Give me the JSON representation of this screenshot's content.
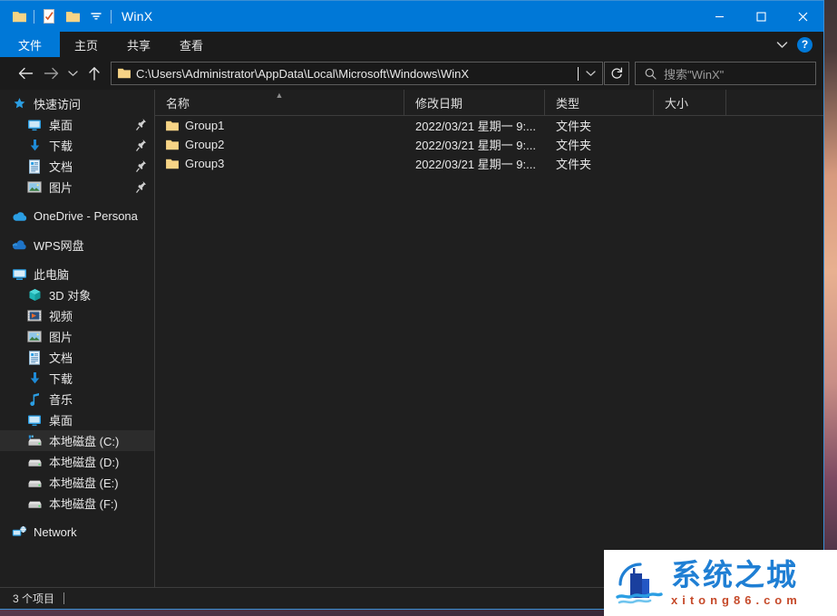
{
  "window": {
    "title": "WinX",
    "quick_access": [
      {
        "name": "folder-icon",
        "label": "新建文件夹"
      },
      {
        "name": "properties-icon",
        "label": "属性"
      },
      {
        "name": "folder-icon",
        "label": "新建文件夹"
      },
      {
        "name": "chevron-down-icon",
        "label": "自定义快速访问工具栏"
      }
    ],
    "controls": {
      "minimize": "—",
      "maximize": "□",
      "close": "✕"
    }
  },
  "ribbon": {
    "tabs": [
      {
        "label": "文件",
        "active": true
      },
      {
        "label": "主页",
        "active": false
      },
      {
        "label": "共享",
        "active": false
      },
      {
        "label": "查看",
        "active": false
      }
    ],
    "collapse_icon": "chevron-down-icon",
    "help_label": "?"
  },
  "nav": {
    "back": "←",
    "forward": "→",
    "recent": "⌄",
    "up": "↑",
    "address_value": "C:\\Users\\Administrator\\AppData\\Local\\Microsoft\\Windows\\WinX",
    "address_dropdown": "chevron-down-icon",
    "refresh": "↻",
    "search_placeholder": "搜索\"WinX\""
  },
  "sidebar": {
    "groups": [
      {
        "header": {
          "label": "快速访问",
          "icon": "pin-star-icon",
          "level": 0
        },
        "items": [
          {
            "label": "桌面",
            "icon": "desktop-icon",
            "level": 1,
            "pinned": true
          },
          {
            "label": "下载",
            "icon": "download-icon",
            "level": 1,
            "pinned": true
          },
          {
            "label": "文档",
            "icon": "document-icon",
            "level": 1,
            "pinned": true
          },
          {
            "label": "图片",
            "icon": "pictures-icon",
            "level": 1,
            "pinned": true
          }
        ]
      },
      {
        "header": {
          "label": "OneDrive - Persona",
          "icon": "onedrive-icon",
          "level": 0
        },
        "items": []
      },
      {
        "header": {
          "label": "WPS网盘",
          "icon": "wps-cloud-icon",
          "level": 0
        },
        "items": []
      },
      {
        "header": {
          "label": "此电脑",
          "icon": "this-pc-icon",
          "level": 0
        },
        "items": [
          {
            "label": "3D 对象",
            "icon": "3d-objects-icon",
            "level": 1,
            "pinned": false
          },
          {
            "label": "视频",
            "icon": "videos-icon",
            "level": 1,
            "pinned": false
          },
          {
            "label": "图片",
            "icon": "pictures-icon",
            "level": 1,
            "pinned": false
          },
          {
            "label": "文档",
            "icon": "document-icon",
            "level": 1,
            "pinned": false
          },
          {
            "label": "下载",
            "icon": "download-icon",
            "level": 1,
            "pinned": false
          },
          {
            "label": "音乐",
            "icon": "music-icon",
            "level": 1,
            "pinned": false
          },
          {
            "label": "桌面",
            "icon": "desktop-icon",
            "level": 1,
            "pinned": false
          },
          {
            "label": "本地磁盘 (C:)",
            "icon": "system-drive-icon",
            "level": 1,
            "pinned": false,
            "highlighted": true
          },
          {
            "label": "本地磁盘 (D:)",
            "icon": "drive-icon",
            "level": 1,
            "pinned": false
          },
          {
            "label": "本地磁盘 (E:)",
            "icon": "drive-icon",
            "level": 1,
            "pinned": false
          },
          {
            "label": "本地磁盘 (F:)",
            "icon": "drive-icon",
            "level": 1,
            "pinned": false
          }
        ]
      },
      {
        "header": {
          "label": "Network",
          "icon": "network-icon",
          "level": 0
        },
        "items": []
      }
    ]
  },
  "filelist": {
    "columns": [
      {
        "key": "name",
        "label": "名称",
        "sorted": "asc"
      },
      {
        "key": "date",
        "label": "修改日期",
        "sorted": null
      },
      {
        "key": "type",
        "label": "类型",
        "sorted": null
      },
      {
        "key": "size",
        "label": "大小",
        "sorted": null
      }
    ],
    "rows": [
      {
        "name": "Group1",
        "date": "2022/03/21 星期一 9:...",
        "type": "文件夹",
        "size": "",
        "icon": "folder-icon"
      },
      {
        "name": "Group2",
        "date": "2022/03/21 星期一 9:...",
        "type": "文件夹",
        "size": "",
        "icon": "folder-icon"
      },
      {
        "name": "Group3",
        "date": "2022/03/21 星期一 9:...",
        "type": "文件夹",
        "size": "",
        "icon": "folder-icon"
      }
    ]
  },
  "status": {
    "item_count": "3 个项目"
  },
  "watermark": {
    "cn": "系统之城",
    "en": "xitong86.com",
    "logo": "building-wave-logo"
  },
  "colors": {
    "accent": "#0078d7",
    "window_bg": "#1f1f1f",
    "titlebar": "#0078d7",
    "folder_yellow": "#f7d486",
    "watermark_blue": "#1f7fd4",
    "watermark_red": "#c64a2a"
  }
}
